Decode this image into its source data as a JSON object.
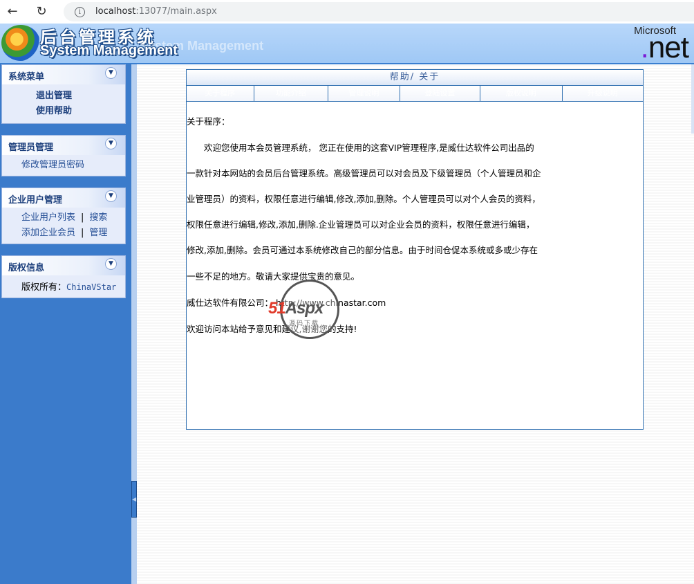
{
  "browser": {
    "url_host": "localhost",
    "url_rest": ":13077/main.aspx"
  },
  "header": {
    "title_cn": "后台管理系统",
    "title_en": "System Management",
    "title_ghost": "System Management",
    "microsoft": "Microsoft",
    "net_text": "net"
  },
  "sidebar": {
    "system_menu": {
      "title": "系统菜单",
      "items": [
        "退出管理",
        "使用帮助"
      ]
    },
    "admin_menu": {
      "title": "管理员管理",
      "items": [
        "修改管理员密码"
      ]
    },
    "company_menu": {
      "title": "企业用户管理",
      "row1": [
        "企业用户列表",
        "搜索"
      ],
      "row2": [
        "添加企业会员",
        "管理"
      ]
    },
    "copyright_menu": {
      "title": "版权信息",
      "label": "版权所有：",
      "owner": "ChinaVStar"
    }
  },
  "panel": {
    "title": "帮助/ 关于",
    "tabs": [
      "关于程序",
      "功能介绍",
      "管理说明",
      "登陆设置",
      "版权说明",
      "升级说明"
    ],
    "lines": [
      "关于程序：",
      "　　欢迎您使用本会员管理系统，  您正在使用的这套VIP管理程序,是威仕达软件公司出品的",
      "一款针对本网站的会员后台管理系统。高级管理员可以对会员及下级管理员（个人管理员和企",
      "业管理员）的资料，权限任意进行编辑,修改,添加,删除。个人管理员可以对个人会员的资料，",
      "权限任意进行编辑,修改,添加,删除.企业管理员可以对企业会员的资料，权限任意进行编辑，",
      "修改,添加,删除。会员可通过本系统修改自己的部分信息。由于时间仓促本系统或多或少存在",
      "一些不足的地方。敬请大家提供宝贵的意见。",
      "威仕达软件有限公司：  http://www.chinastar.com",
      "欢迎访问本站给予意见和建议,谢谢您的支持!"
    ]
  },
  "watermark": {
    "num": "51",
    "word": "Aspx",
    "sub": "源码下载"
  }
}
